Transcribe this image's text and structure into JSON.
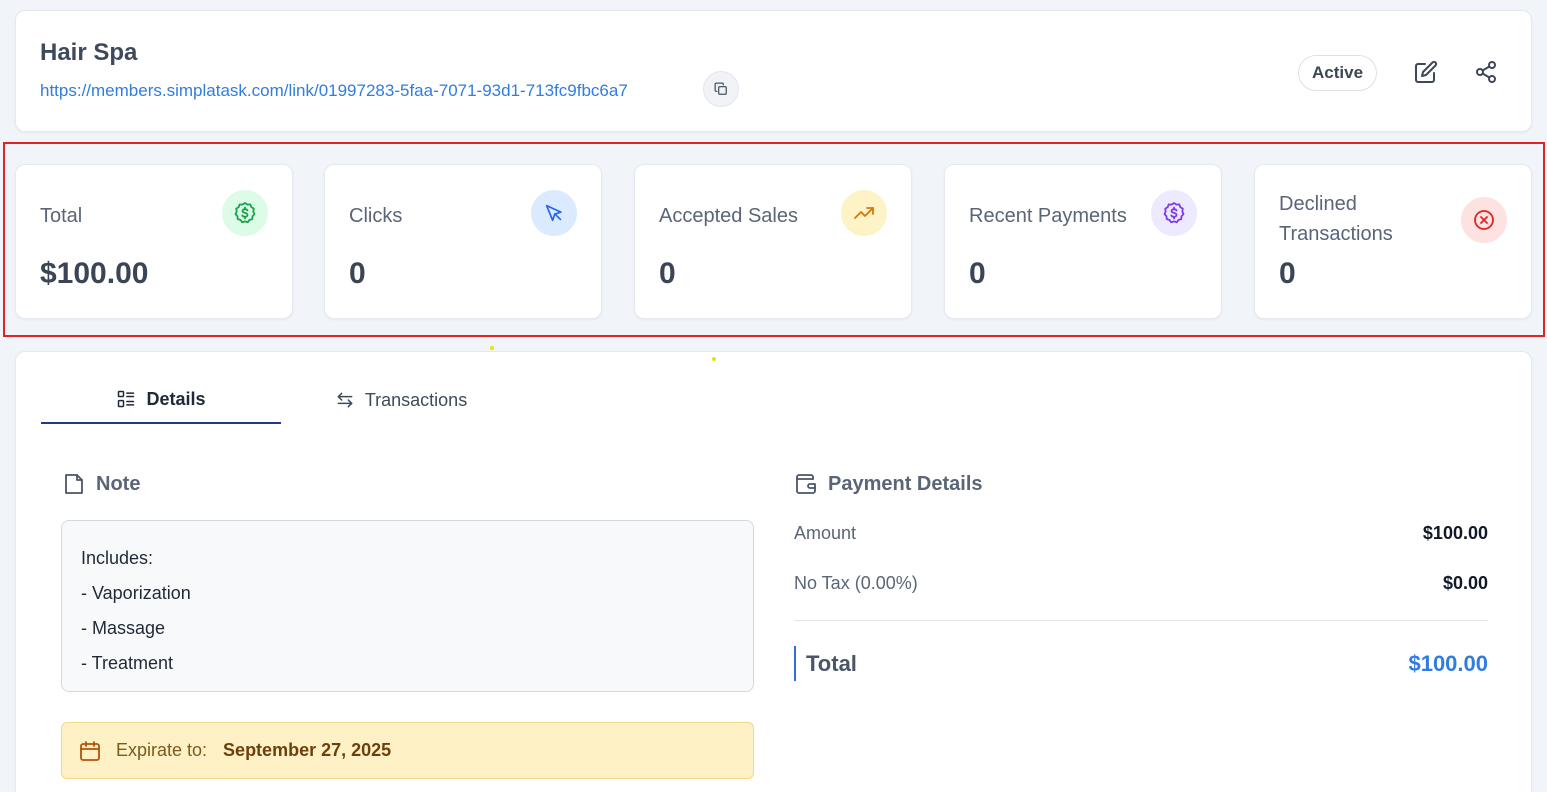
{
  "link": {
    "title": "Hair Spa",
    "url": "https://members.simplatask.com/link/01997283-5faa-7071-93d1-713fc9fbc6a7",
    "status": "Active"
  },
  "stats": [
    {
      "label": "Total",
      "value": "$100.00",
      "icon": "dollar-badge-icon",
      "color": "#16a34a",
      "bg": "#dcfce7"
    },
    {
      "label": "Clicks",
      "value": "0",
      "icon": "cursor-pointer-icon",
      "color": "#2563eb",
      "bg": "#dbeafe"
    },
    {
      "label": "Accepted Sales",
      "value": "0",
      "icon": "trending-up-icon",
      "color": "#d97706",
      "bg": "#fef3c7"
    },
    {
      "label": "Recent Payments",
      "value": "0",
      "icon": "dollar-badge-icon",
      "color": "#7c3aed",
      "bg": "#ede9fe"
    },
    {
      "label": "Declined Transactions",
      "value": "0",
      "icon": "x-circle-icon",
      "color": "#dc2626",
      "bg": "#fee2e2"
    }
  ],
  "tabs": [
    {
      "label": "Details",
      "icon": "list-details-icon",
      "active": true
    },
    {
      "label": "Transactions",
      "icon": "arrows-swap-icon",
      "active": false
    }
  ],
  "note": {
    "title": "Note",
    "lines": [
      "Includes:",
      "- Vaporization",
      "- Massage",
      "- Treatment"
    ]
  },
  "expiration": {
    "label": "Expirate to:",
    "date": "September 27, 2025"
  },
  "payment": {
    "title": "Payment Details",
    "rows": [
      {
        "label": "Amount",
        "value": "$100.00"
      },
      {
        "label": "No Tax (0.00%)",
        "value": "$0.00"
      }
    ],
    "total_label": "Total",
    "total_value": "$100.00"
  },
  "colors": {
    "accent": "#2f7de1",
    "highlight": "#e02424"
  }
}
